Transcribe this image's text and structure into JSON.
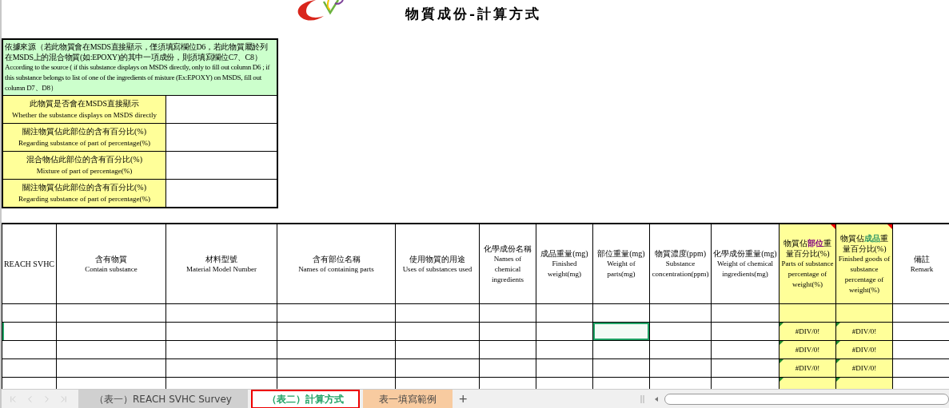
{
  "title": "物質成份-計算方式",
  "source_note": {
    "zh": "依據來源（若此物質會在MSDS直接顯示，僅須填寫欄位D6，若此物質屬於列在MSDS上的混合物質(如:EPOXY)的其中一項成份，則須填寫欄位C7、C8）",
    "en": "According to the source ( if this substance displays on MSDS directly, only to fill out column D6 ; if this substance belongs to list  of one of the ingredients of misture (Ex:EPOXY) on MSDS, fill out column D7、D8）"
  },
  "source_rows": [
    {
      "zh": "此物質是否會在MSDS直接顯示",
      "en": "Whether the substance displays on MSDS directly"
    },
    {
      "zh": "關注物質佔此部位的含有百分比(%)",
      "en": "Regarding substance of part of percentage(%)"
    },
    {
      "zh": "混合物佔此部位的含有百分比(%)",
      "en": "Mixture of part of percentage(%)"
    },
    {
      "zh": "關注物質佔此部位的含有百分比(%)",
      "en": "Regarding substance of part of percentage(%)"
    }
  ],
  "columns": [
    {
      "en": "REACH SVHC",
      "highlight": false,
      "comment": false
    },
    {
      "zh": "含有物質",
      "en": "Contain substance",
      "highlight": false,
      "comment": false
    },
    {
      "zh": "材料型號",
      "en": "Material Model Number",
      "highlight": false,
      "comment": false
    },
    {
      "zh": "含有部位名稱",
      "en": "Names of containing parts",
      "highlight": false,
      "comment": false
    },
    {
      "zh": "使用物質的用途",
      "en": "Uses of substances used",
      "highlight": false,
      "comment": false
    },
    {
      "zh": "化學成份名稱",
      "en": "Names of chemical ingredients",
      "highlight": false,
      "comment": false
    },
    {
      "zh": "成品重量(mg)",
      "en": "Finished weight(mg)",
      "highlight": false,
      "comment": false
    },
    {
      "zh": "部位重量(mg)",
      "en": "Weight of parts(mg)",
      "highlight": false,
      "comment": false
    },
    {
      "zh": "物質濃度(ppm)",
      "en": "Substance concentration(ppm)",
      "highlight": false,
      "comment": false
    },
    {
      "zh": "化學成份重量(mg)",
      "en": "Weight of chemical ingredients(mg)",
      "highlight": false,
      "comment": false
    },
    {
      "zh": "物質佔",
      "zh_mark": "部位",
      "color": "#800080",
      "zh_after": "重量百分比(%)",
      "en": "Parts of substance percentage of weight(%)",
      "highlight": true,
      "comment": true
    },
    {
      "zh": "物質佔",
      "zh_mark": "成品",
      "color": "#339966",
      "zh_after": "重量百分比(%)",
      "en": "Finished goods of substance percentage of weight(%)",
      "highlight": true,
      "comment": true
    },
    {
      "zh": "備註",
      "en": "Remark",
      "highlight": false,
      "comment": false
    }
  ],
  "rows": [
    {
      "selected": false,
      "error_flag": false
    },
    {
      "selected": true,
      "error_flag": true,
      "part_share": "#DIV/0!",
      "finished_share": "#DIV/0!"
    },
    {
      "selected": false,
      "error_flag": true,
      "part_share": "#DIV/0!",
      "finished_share": "#DIV/0!"
    },
    {
      "selected": false,
      "error_flag": true,
      "part_share": "#DIV/0!",
      "finished_share": "#DIV/0!"
    },
    {
      "selected": false,
      "error_flag": true
    }
  ],
  "sheet_tabs": [
    {
      "label": "（表一）REACH SVHC Survey",
      "selected": false,
      "color": "#d0d0d0"
    },
    {
      "label": "（表二）計算方式",
      "selected": true,
      "color": "#ffffff"
    },
    {
      "label": "表一填寫範例",
      "selected": false,
      "color": "#f8cba0"
    }
  ],
  "add_sheet": "+"
}
